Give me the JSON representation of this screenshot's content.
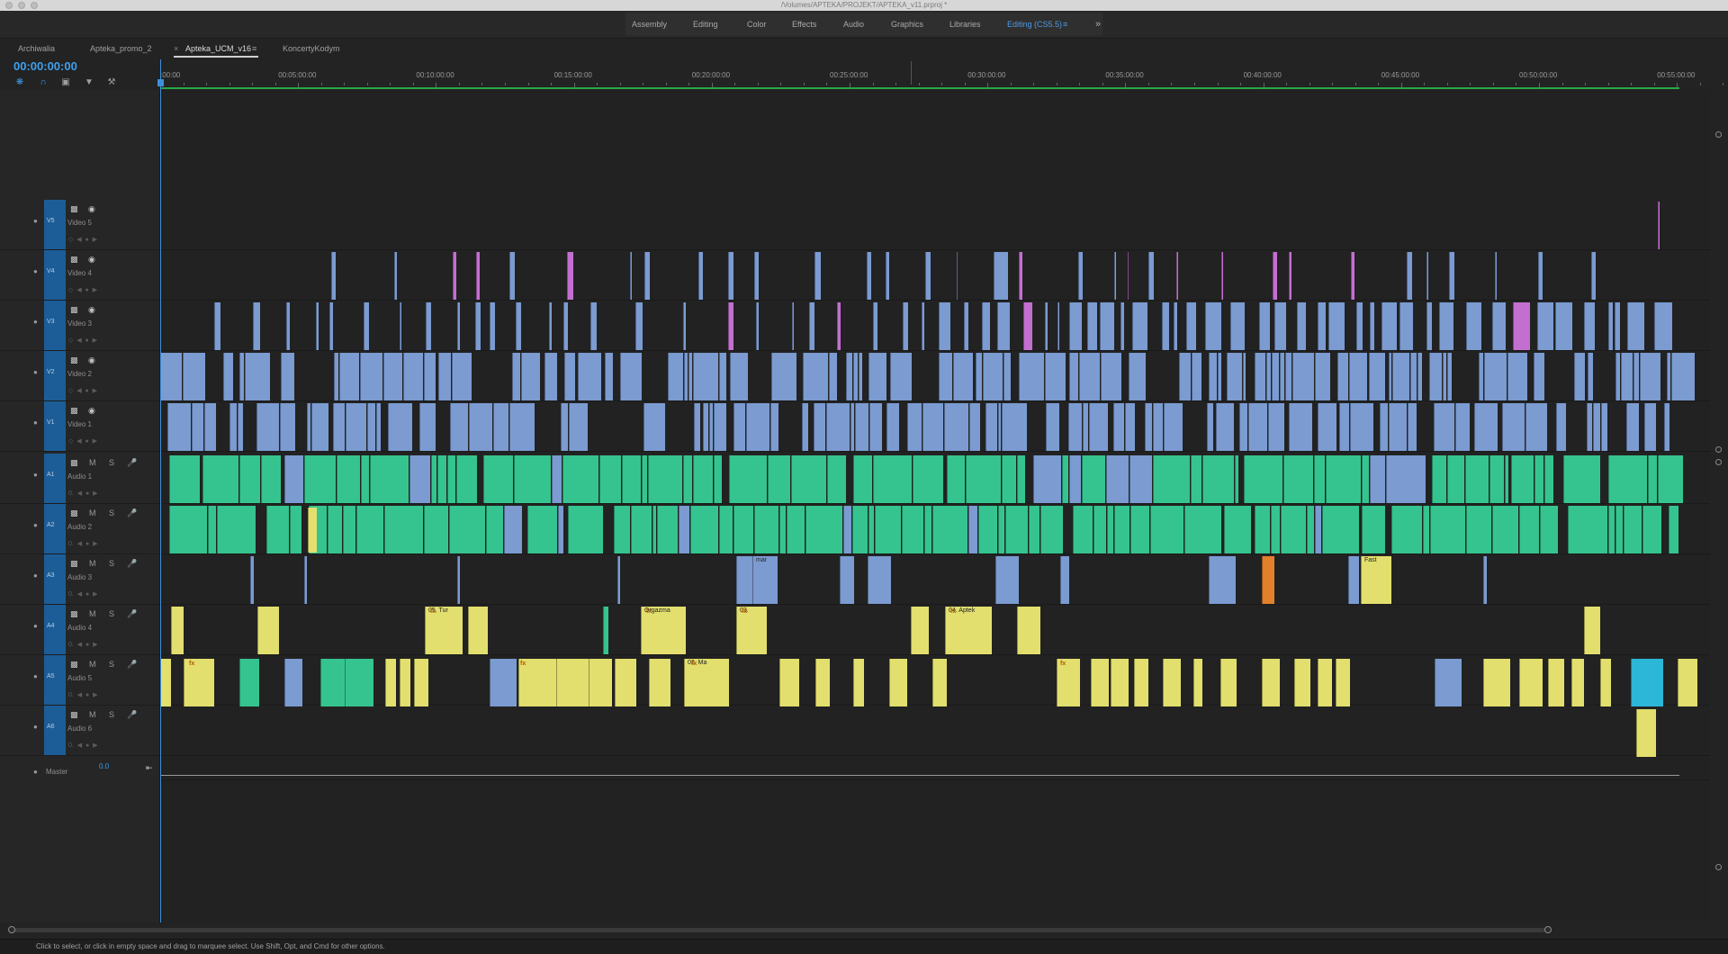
{
  "window": {
    "title": "/Volumes/APTEKA/PROJEKT/APTEKA_v11.prproj *"
  },
  "workspaces": [
    {
      "label": "Assembly",
      "active": false
    },
    {
      "label": "Editing",
      "active": false
    },
    {
      "label": "Color",
      "active": false
    },
    {
      "label": "Effects",
      "active": false
    },
    {
      "label": "Audio",
      "active": false
    },
    {
      "label": "Graphics",
      "active": false
    },
    {
      "label": "Libraries",
      "active": false
    },
    {
      "label": "Editing (CS5.5)",
      "active": true
    }
  ],
  "workspace_overflow_icon": "chevrons-right-icon",
  "sequence_tabs": [
    {
      "label": "Archiwalia",
      "active": false
    },
    {
      "label": "Apteka_promo_2",
      "active": false
    },
    {
      "label": "Apteka_UCM_v16",
      "active": true
    },
    {
      "label": "KoncertyKodym",
      "active": false
    }
  ],
  "timecode": "00:00:00:00",
  "tools": [
    "nest-icon",
    "snap-magnet-icon",
    "linked-selection-icon",
    "add-marker-icon",
    "wrench-icon"
  ],
  "ruler": {
    "labels": [
      ":00:00",
      "00:05:00:00",
      "00:10:00:00",
      "00:15:00:00",
      "00:20:00:00",
      "00:25:00:00",
      "00:30:00:00",
      "00:35:00:00",
      "00:40:00:00",
      "00:45:00:00",
      "00:50:00:00",
      "00:55:00:00"
    ]
  },
  "video_tracks": [
    {
      "id": "V5",
      "name": "Video 5"
    },
    {
      "id": "V4",
      "name": "Video 4"
    },
    {
      "id": "V3",
      "name": "Video 3"
    },
    {
      "id": "V2",
      "name": "Video 2"
    },
    {
      "id": "V1",
      "name": "Video 1"
    }
  ],
  "audio_tracks": [
    {
      "id": "A1",
      "name": "Audio 1",
      "m": "M",
      "s": "S"
    },
    {
      "id": "A2",
      "name": "Audio 2",
      "m": "M",
      "s": "S"
    },
    {
      "id": "A3",
      "name": "Audio 3",
      "m": "M",
      "s": "S"
    },
    {
      "id": "A4",
      "name": "Audio 4",
      "m": "M",
      "s": "S"
    },
    {
      "id": "A5",
      "name": "Audio 5",
      "m": "M",
      "s": "S"
    },
    {
      "id": "A6",
      "name": "Audio 6",
      "m": "M",
      "s": "S"
    }
  ],
  "master": {
    "label": "Master",
    "value": "0.0"
  },
  "clip_labels": {
    "a4": [
      "05. Tur",
      "Orgazma",
      "03.",
      "04. Aptek"
    ],
    "a5": [
      "02. Ma"
    ],
    "a3": [
      "mar",
      "Fast"
    ]
  },
  "colors": {
    "video_clip": "#7b9bd1",
    "audio_green": "#35c48f",
    "audio_yellow": "#e2df6e",
    "audio_cyan": "#2cb7d8",
    "accent_blue": "#3ea1ee",
    "work_area_green": "#29a845"
  },
  "status": "Click to select, or click in empty space and drag to marquee select. Use Shift, Opt, and Cmd for other options."
}
